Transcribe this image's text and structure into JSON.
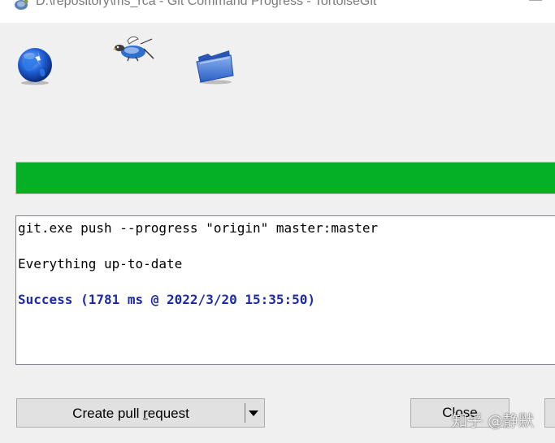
{
  "window": {
    "title": "D:\\repository\\ms_rca - Git Command Progress - TortoiseGit",
    "minimize_glyph": "—"
  },
  "icons": {
    "app": "tortoisegit-icon",
    "globe": "globe-icon",
    "bird": "tortoise-bird-icon",
    "folder": "folder-icon"
  },
  "progress": {
    "value_fraction": 1.0,
    "color": "#06b025"
  },
  "log": {
    "lines": [
      "git.exe push --progress \"origin\" master:master",
      "Everything up-to-date",
      "Success (1781 ms @ 2022/3/20 15:35:50)"
    ],
    "success_color": "#1c2aa8"
  },
  "buttons": {
    "create_pr_label_pre": "Create pull ",
    "create_pr_label_accel": "r",
    "create_pr_label_post": "equest",
    "close_label": "Close"
  },
  "watermark": "知乎 @静默"
}
